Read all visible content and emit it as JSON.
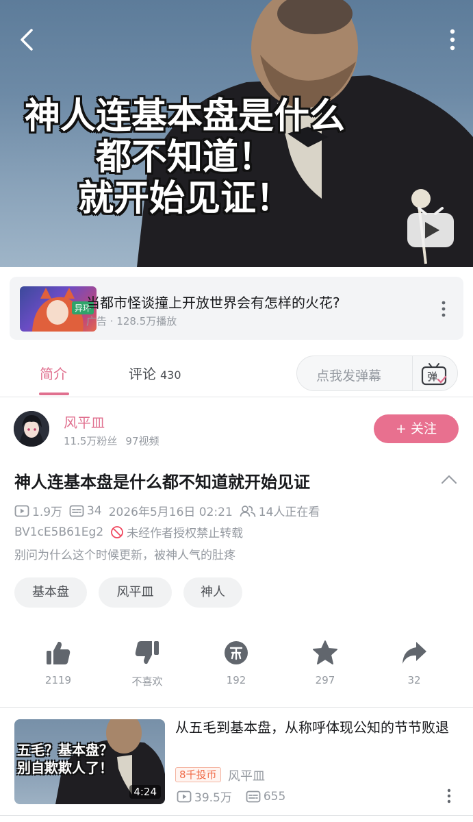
{
  "player": {
    "overlay_caption": [
      "神人连基本盘是什么",
      "都不知道！",
      "就开始见证！"
    ],
    "icons": {
      "back": "back-arrow-icon",
      "more": "more-vertical-icon",
      "play": "tv-play-icon"
    }
  },
  "ad": {
    "title": "当都市怪谈撞上开放世界会有怎样的火花?",
    "meta": "广告 · 128.5万播放",
    "thumb_badge": "异环"
  },
  "tabs": {
    "intro_label": "简介",
    "comments_label": "评论",
    "comments_count": "430",
    "danmaku_placeholder": "点我发弹幕",
    "danmaku_icon_text": "弹"
  },
  "uploader": {
    "name": "风平皿",
    "fans": "11.5万粉丝",
    "videos": "97视频",
    "follow_label": "+ 关注"
  },
  "video": {
    "title": "神人连基本盘是什么都不知道就开始见证",
    "plays": "1.9万",
    "danmaku_count": "34",
    "date": "2026年5月16日 02:21",
    "watching": "14人正在看",
    "bvid": "BV1cE5B61Eg2",
    "copyright": "未经作者授权禁止转载",
    "description": "别问为什么这个时候更新，被神人气的肚疼"
  },
  "tags": [
    "基本盘",
    "风平皿",
    "神人"
  ],
  "actions": {
    "like": "2119",
    "dislike": "不喜欢",
    "coin": "192",
    "favorite": "297",
    "share": "32"
  },
  "related": {
    "title": "从五毛到基本盘，从称呼体现公知的节节败退",
    "thumb_caption": [
      "五毛？基本盘？",
      "别自欺欺人了！"
    ],
    "duration": "4:24",
    "badge": "8千投币",
    "author": "风平皿",
    "plays": "39.5万",
    "danmaku": "655"
  },
  "colors": {
    "accent": "#e0708f",
    "follow_button": "#e8708f",
    "muted_text": "#9499a0",
    "divider": "#e3e5e7",
    "coin_badge": "#f06a47"
  }
}
